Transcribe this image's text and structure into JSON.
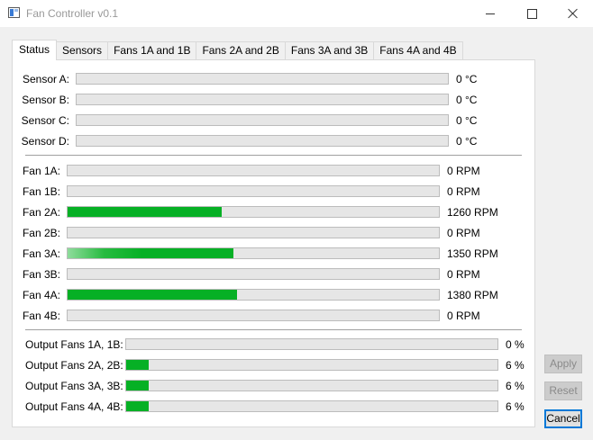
{
  "window": {
    "title": "Fan Controller v0.1"
  },
  "tabs": [
    {
      "label": "Status",
      "active": true
    },
    {
      "label": "Sensors",
      "active": false
    },
    {
      "label": "Fans 1A and 1B",
      "active": false
    },
    {
      "label": "Fans 2A and 2B",
      "active": false
    },
    {
      "label": "Fans 3A and 3B",
      "active": false
    },
    {
      "label": "Fans 4A and 4B",
      "active": false
    }
  ],
  "sensors": [
    {
      "label": "Sensor A:",
      "value": "0 °C",
      "level": 0
    },
    {
      "label": "Sensor B:",
      "value": "0 °C",
      "level": 0
    },
    {
      "label": "Sensor C:",
      "value": "0 °C",
      "level": 0
    },
    {
      "label": "Sensor D:",
      "value": "0 °C",
      "level": 0
    }
  ],
  "fans": [
    {
      "label": "Fan 1A:",
      "value": "0 RPM",
      "level": 0
    },
    {
      "label": "Fan 1B:",
      "value": "0 RPM",
      "level": 0
    },
    {
      "label": "Fan 2A:",
      "value": "1260 RPM",
      "level": 0.415
    },
    {
      "label": "Fan 2B:",
      "value": "0 RPM",
      "level": 0
    },
    {
      "label": "Fan 3A:",
      "value": "1350 RPM",
      "level": 0.446
    },
    {
      "label": "Fan 3B:",
      "value": "0 RPM",
      "level": 0
    },
    {
      "label": "Fan 4A:",
      "value": "1380 RPM",
      "level": 0.456
    },
    {
      "label": "Fan 4B:",
      "value": "0 RPM",
      "level": 0
    }
  ],
  "outputs": [
    {
      "label": "Output Fans 1A, 1B:",
      "value": "0 %",
      "level": 0
    },
    {
      "label": "Output Fans 2A, 2B:",
      "value": "6 %",
      "level": 0.06
    },
    {
      "label": "Output Fans 3A, 3B:",
      "value": "6 %",
      "level": 0.06
    },
    {
      "label": "Output Fans 4A, 4B:",
      "value": "6 %",
      "level": 0.06
    }
  ],
  "buttons": {
    "apply": "Apply",
    "reset": "Reset",
    "cancel": "Cancel"
  },
  "colors": {
    "progress_fill": "#06b025",
    "progress_track": "#e6e6e6"
  }
}
